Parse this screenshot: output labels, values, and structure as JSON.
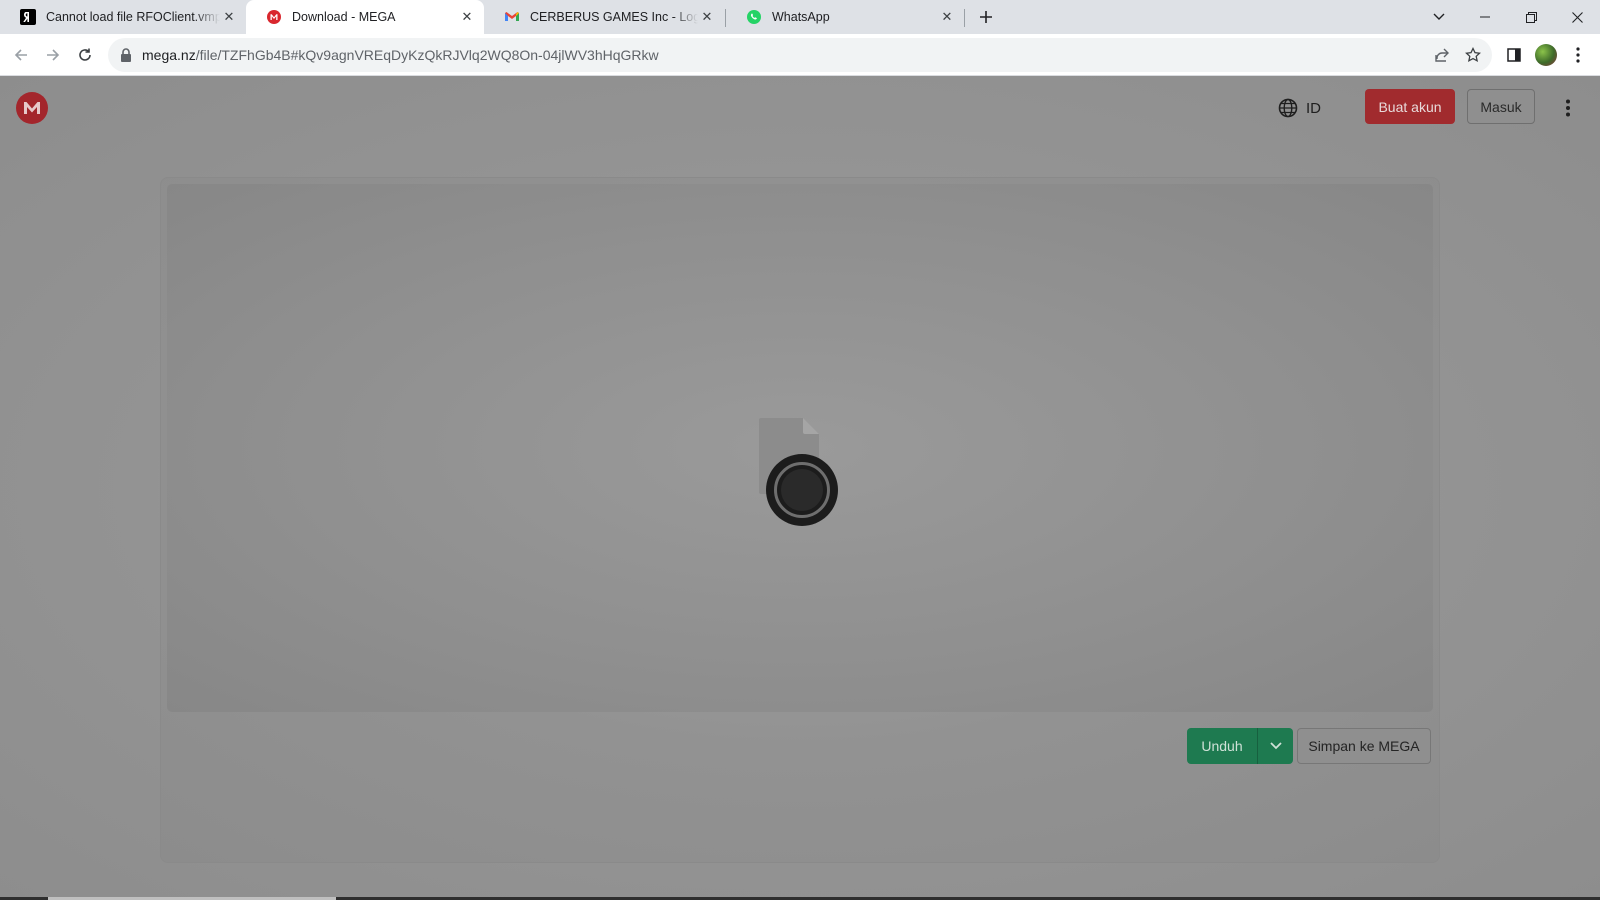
{
  "browser": {
    "tabs": [
      {
        "title": "Cannot load file RFOClient.vmp.",
        "favicon": "yandex-y-icon",
        "active": false
      },
      {
        "title": "Download - MEGA",
        "favicon": "mega-icon",
        "active": true
      },
      {
        "title": "CERBERUS GAMES Inc - Login ve",
        "favicon": "gmail-icon",
        "active": false
      },
      {
        "title": "WhatsApp",
        "favicon": "whatsapp-icon",
        "active": false
      }
    ],
    "url_domain": "mega.nz",
    "url_path": "/file/TZFhGb4B#kQv9agnVREqDyKzQkRJVlq2WQ8On-04jlWV3hHqGRkw"
  },
  "header": {
    "language_code": "ID",
    "signup_label": "Buat akun",
    "login_label": "Masuk"
  },
  "viewer": {
    "download_label": "Unduh",
    "save_label": "Simpan ke MEGA"
  },
  "colors": {
    "mega_red": "#a3262c",
    "download_green": "#1e7a50",
    "overlay_gray": "#8f8f8f"
  }
}
